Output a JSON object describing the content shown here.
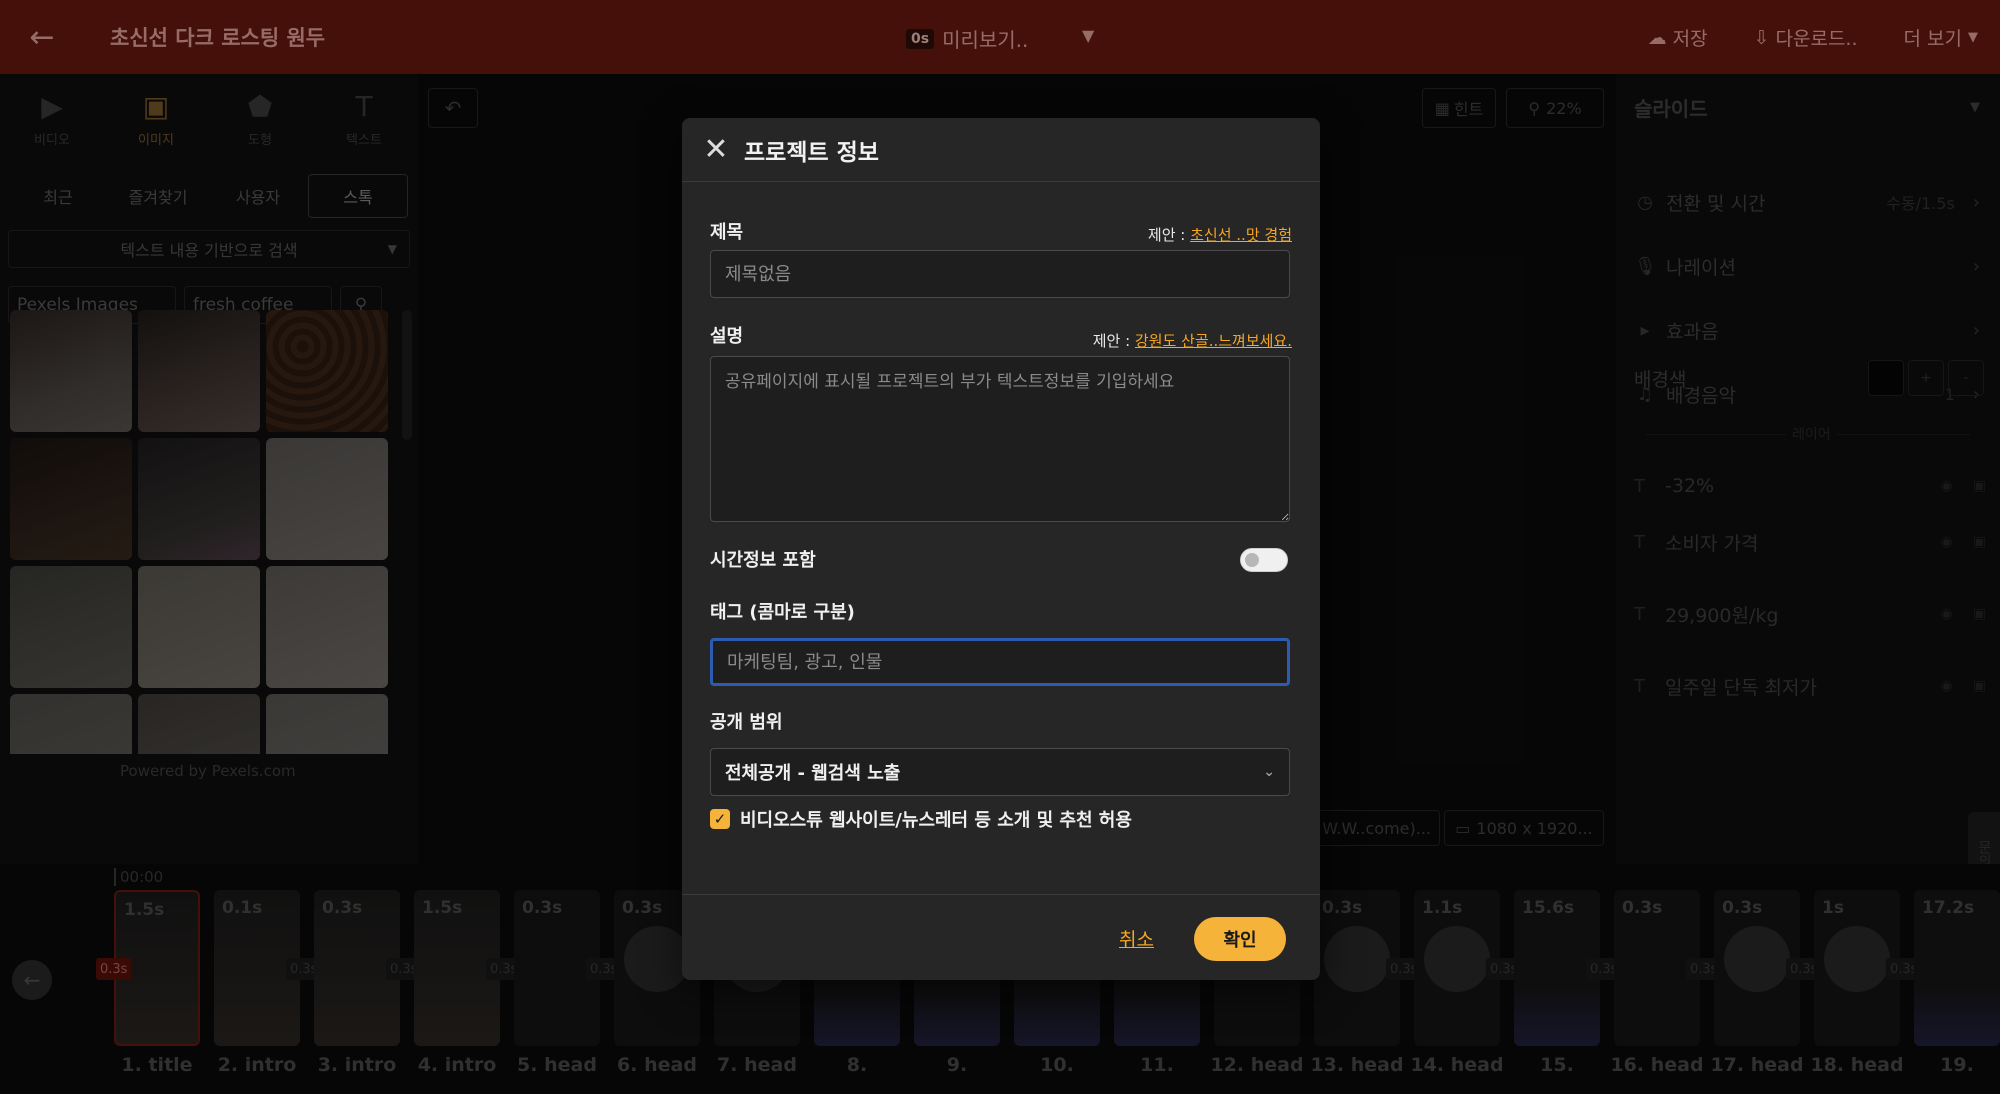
{
  "topbar": {
    "back_icon": "arrow-left-icon",
    "project_title": "초신선 다크 로스팅 원두",
    "preview_badge": "0s",
    "preview_label": "미리보기..",
    "save_label": "저장",
    "download_label": "다운로드..",
    "more_label": "더 보기"
  },
  "left_panel": {
    "media_tabs": [
      {
        "label": "비디오",
        "icon": "video-icon"
      },
      {
        "label": "이미지",
        "icon": "image-icon"
      },
      {
        "label": "도형",
        "icon": "shape-icon"
      },
      {
        "label": "텍스트",
        "icon": "text-icon"
      }
    ],
    "lib_tabs": [
      "최근",
      "즐겨찾기",
      "사용자",
      "스톡"
    ],
    "search_mode": "텍스트 내용 기반으로 검색",
    "source": "Pexels Images",
    "query": "fresh coffee",
    "powered_by": "Powered by Pexels.com"
  },
  "canvas": {
    "hint_label": "힌트",
    "zoom_label": "22%",
    "url_chip": "W.W..come)...",
    "size_chip": "1080 x 1920..."
  },
  "right_panel": {
    "title": "슬라이드",
    "items": [
      {
        "label": "전환 및 시간",
        "value": "수동/1.5s",
        "icon": "clock-icon"
      },
      {
        "label": "나레이션",
        "value": "",
        "icon": "mic-icon"
      },
      {
        "label": "효과음",
        "value": "",
        "icon": "speaker-icon"
      },
      {
        "label": "배경음악",
        "value": "1",
        "icon": "music-icon"
      }
    ],
    "bg_label": "배경색",
    "divider_label": "레이어",
    "layers": [
      "-32%",
      "소비자 가격",
      "29,900원/kg",
      "일주일 단독 최저가"
    ],
    "side_tab": "문의"
  },
  "timeline": {
    "time": "00:00",
    "clips": [
      {
        "dur": "1.5s",
        "label": "1. title",
        "trans": "0.3s"
      },
      {
        "dur": "0.1s",
        "label": "2. intro",
        "trans": "0.3s"
      },
      {
        "dur": "0.3s",
        "label": "3. intro",
        "trans": "0.3s"
      },
      {
        "dur": "1.5s",
        "label": "4. intro",
        "trans": "0.3s"
      },
      {
        "dur": "0.3s",
        "label": "5. head",
        "trans": "0.3s"
      },
      {
        "dur": "0.3s",
        "label": "6. head",
        "trans": ""
      },
      {
        "dur": "",
        "label": "7. head",
        "trans": ""
      },
      {
        "dur": "",
        "label": "8.",
        "trans": ""
      },
      {
        "dur": "",
        "label": "9.",
        "trans": ""
      },
      {
        "dur": "",
        "label": "10.",
        "trans": ""
      },
      {
        "dur": "",
        "label": "11.",
        "trans": ""
      },
      {
        "dur": "",
        "label": "12. head",
        "trans": ""
      },
      {
        "dur": "0.3s",
        "label": "13. head",
        "trans": "0.3s"
      },
      {
        "dur": "1.1s",
        "label": "14. head",
        "trans": "0.3s"
      },
      {
        "dur": "15.6s",
        "label": "15.",
        "trans": "0.3s"
      },
      {
        "dur": "0.3s",
        "label": "16. head",
        "trans": "0.3s"
      },
      {
        "dur": "0.3s",
        "label": "17. head",
        "trans": "0.3s"
      },
      {
        "dur": "1s",
        "label": "18. head",
        "trans": "0.3s"
      },
      {
        "dur": "17.2s",
        "label": "19.",
        "trans": ""
      }
    ]
  },
  "modal": {
    "title": "프로젝트 정보",
    "close_icon": "close-icon",
    "title_field": {
      "label": "제목",
      "suggest_prefix": "제안 :",
      "suggest_value": "초신선 ..맛 경험",
      "placeholder": "제목없음",
      "value": ""
    },
    "desc_field": {
      "label": "설명",
      "suggest_prefix": "제안 :",
      "suggest_value": "강원도 산골..느껴보세요.",
      "placeholder": "공유페이지에 표시될 프로젝트의 부가 텍스트정보를 기입하세요",
      "value": ""
    },
    "time_toggle": {
      "label": "시간정보 포함",
      "on": false
    },
    "tags_field": {
      "label": "태그 (콤마로 구분)",
      "placeholder": "마케팅팀, 광고, 인물",
      "value": ""
    },
    "visibility": {
      "label": "공개 범위",
      "selected": "전체공개 - 웹검색 노출"
    },
    "promo_checkbox": {
      "label": "비디오스튜 웹사이트/뉴스레터 등 소개 및 추천 허용",
      "checked": true
    },
    "cancel_label": "취소",
    "ok_label": "확인"
  },
  "colors": {
    "accent": "#f5b33a",
    "link": "#f5a623",
    "focus_border": "#2d5bb0",
    "modal_bg": "#262626",
    "topbar_bg": "#6a1a10"
  }
}
